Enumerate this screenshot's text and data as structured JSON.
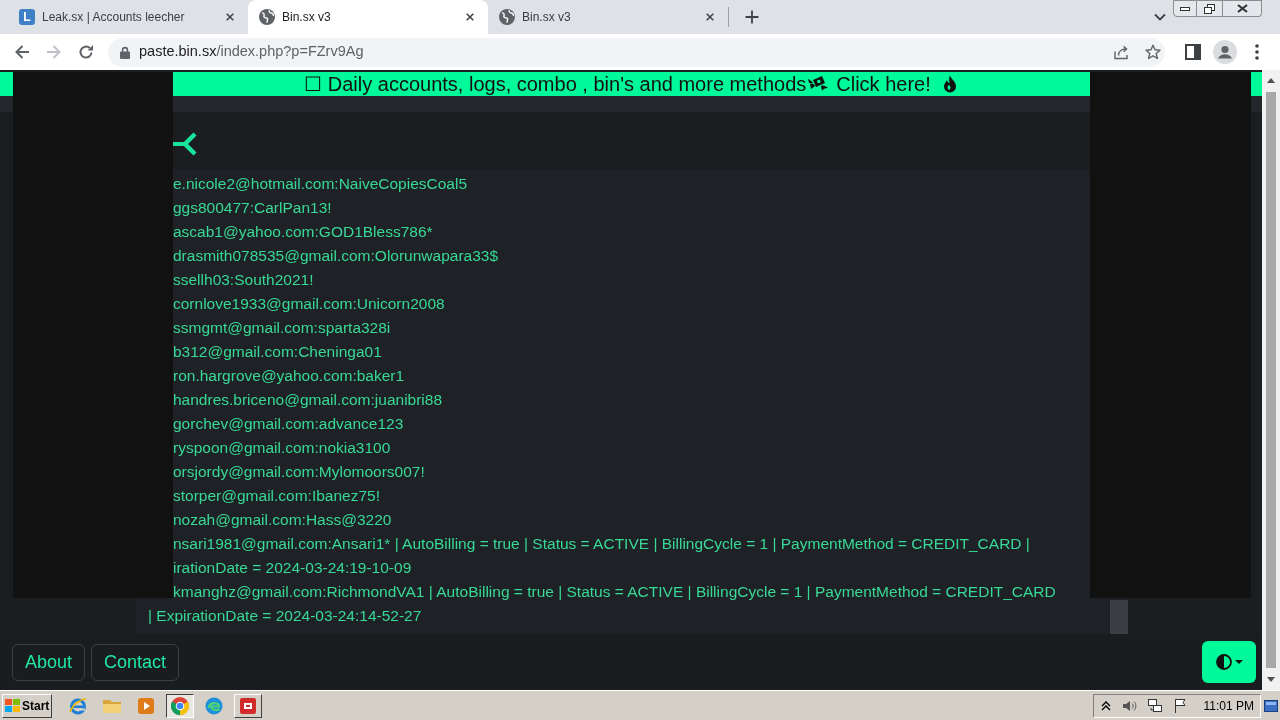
{
  "browser": {
    "tabs": [
      {
        "title": "Leak.sx | Accounts leecher",
        "favicon": "L",
        "selected": false
      },
      {
        "title": "Bin.sx v3",
        "selected": true
      },
      {
        "title": "Bin.sx v3",
        "selected": false
      }
    ],
    "address_bar": {
      "host": "paste.bin.sx",
      "path": "/index.php?p=FZrv9Ag"
    }
  },
  "banner": {
    "text": "☐ Daily accounts, logs, combo , bin's and more methods",
    "link": "Click here!"
  },
  "paste": {
    "lines": [
      "e.nicole2@hotmail.com:NaiveCopiesCoal5",
      "ggs800477:CarlPan13!",
      "ascab1@yahoo.com:GOD1Bless786*",
      "drasmith078535@gmail.com:Olorunwapara33$",
      "ssellh03:South2021!",
      "cornlove1933@gmail.com:Unicorn2008",
      "ssmgmt@gmail.com:sparta328i",
      "b312@gmail.com:Cheninga01",
      "ron.hargrove@yahoo.com:baker1",
      "handres.briceno@gmail.com:juanibri88",
      "gorchev@gmail.com:advance123",
      "ryspoon@gmail.com:nokia3100",
      "orsjordy@gmail.com:Mylomoors007!",
      "storper@gmail.com:Ibanez75!",
      "nozah@gmail.com:Hass@3220",
      "nsari1981@gmail.com:Ansari1* | AutoBilling = true | Status = ACTIVE | BillingCycle = 1 | PaymentMethod = CREDIT_CARD |",
      "irationDate = 2024-03-24:19-10-09",
      "kmanghz@gmail.com:RichmondVA1 | AutoBilling = true | Status = ACTIVE | BillingCycle = 1 | PaymentMethod = CREDIT_CARD"
    ]
  },
  "paste_below_frame": {
    "lines": [
      "| ExpirationDate = 2024-03-24:14-52-27"
    ]
  },
  "footer": {
    "links": [
      "About",
      "Contact"
    ]
  },
  "taskbar": {
    "start": "Start",
    "apps": [
      {
        "kind": "ie",
        "selected": false,
        "open": false
      },
      {
        "kind": "folder",
        "selected": false,
        "open": false
      },
      {
        "kind": "media",
        "selected": false,
        "open": false
      },
      {
        "kind": "chrome",
        "selected": true,
        "open": true
      },
      {
        "kind": "edge",
        "selected": false,
        "open": false
      },
      {
        "kind": "app",
        "selected": false,
        "open": true
      }
    ],
    "clock": "11:01 PM"
  }
}
